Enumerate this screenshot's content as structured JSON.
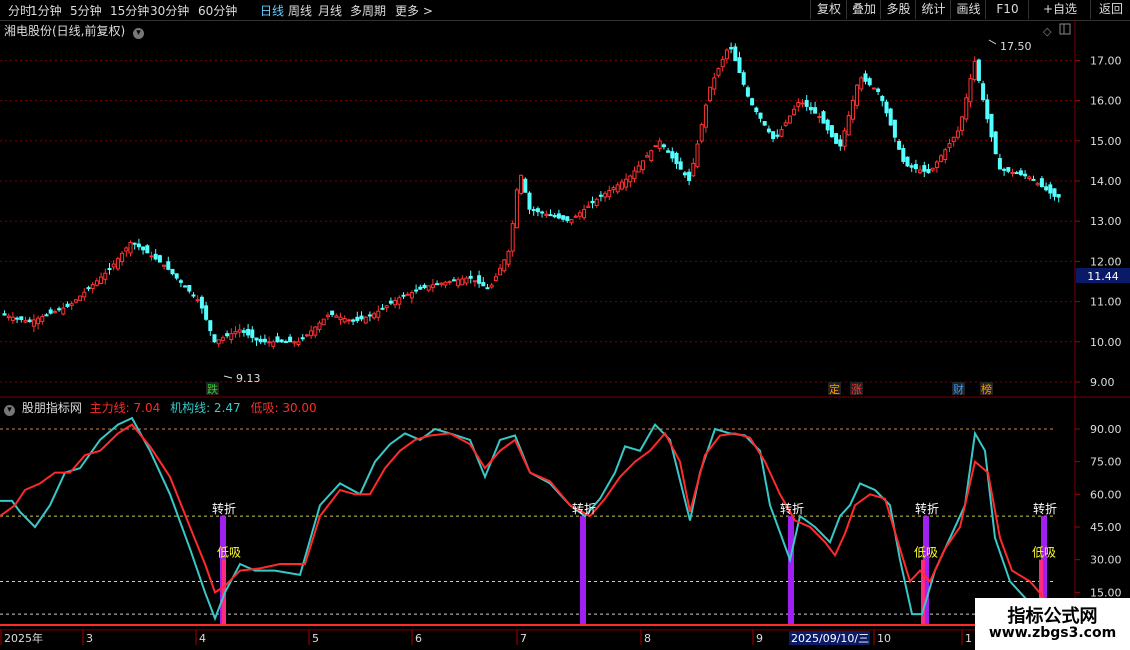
{
  "toolbar": {
    "periods": [
      "分时",
      "1分钟",
      "5分钟",
      "15分钟",
      "30分钟",
      "60分钟",
      "日线",
      "周线",
      "月线",
      "多周期",
      "更多 >"
    ],
    "active_period": "日线",
    "buttons": [
      "复权",
      "叠加",
      "多股",
      "统计",
      "画线",
      "F10",
      "+自选",
      "返回"
    ]
  },
  "main_chart": {
    "title": "湘电股份(日线,前复权)",
    "high_label": "17.50",
    "low_label": "9.13",
    "current_price_tag": "11.44",
    "y_axis_labels": [
      "17.00",
      "16.00",
      "15.00",
      "14.00",
      "13.00",
      "12.00",
      "11.00",
      "10.00",
      "9.00"
    ],
    "event_markers": [
      {
        "text": "跌",
        "color": "#3c3"
      },
      {
        "text": "定",
        "color": "#f90"
      },
      {
        "text": "涨",
        "color": "#f33"
      },
      {
        "text": "财",
        "color": "#39f"
      },
      {
        "text": "榜",
        "color": "#f90"
      }
    ],
    "colors": {
      "up": "#ff3333",
      "down": "#54ffff",
      "grid": "#7a0000"
    }
  },
  "indicator": {
    "name": "股朋指标网",
    "line1_label": "主力线: 7.04",
    "line2_label": "机构线: 2.47",
    "line3_label": "低吸: 30.00",
    "y_axis_labels": [
      "90.00",
      "75.00",
      "60.00",
      "45.00",
      "30.00",
      "15.00"
    ],
    "signals_turn": [
      "转折",
      "转折",
      "转折",
      "转折",
      "转折"
    ],
    "signals_low": [
      "低吸",
      "低吸",
      "低吸"
    ],
    "colors": {
      "main": "#ff2a2a",
      "inst": "#38c8c8",
      "bar": "#a020f0",
      "signal_text": "#fff",
      "low_text": "#ff3"
    }
  },
  "x_axis": {
    "labels": [
      "2025年",
      "3",
      "4",
      "5",
      "6",
      "7",
      "8",
      "9",
      "10",
      "1"
    ],
    "cursor_date": "2025/09/10/三"
  },
  "watermark": {
    "title": "指标公式网",
    "url": "www.zbgs3.com"
  }
}
